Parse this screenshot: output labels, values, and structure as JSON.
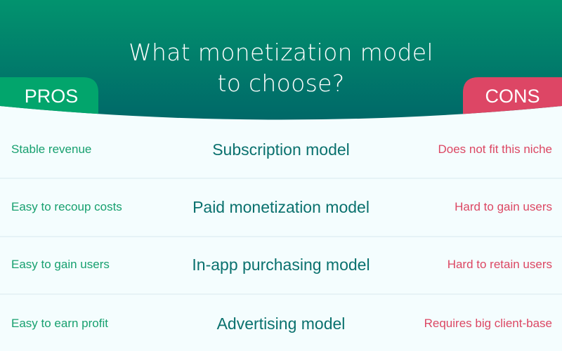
{
  "title": {
    "line1": "What monetization model",
    "line2": "to choose?"
  },
  "tabs": {
    "pros": "PROS",
    "cons": "CONS"
  },
  "colors": {
    "header_top": "#02936e",
    "header_bottom": "#006a69",
    "pros_accent": "#02a56c",
    "cons_accent": "#dd4665",
    "pros_text": "#17a06f",
    "cons_text": "#dc4763",
    "model_text": "#0a716e",
    "background": "#f4fdfe"
  },
  "rows": [
    {
      "pro": "Stable revenue",
      "model": "Subscription model",
      "con": "Does not fit this niche"
    },
    {
      "pro": "Easy to recoup costs",
      "model": "Paid monetization model",
      "con": "Hard to gain users"
    },
    {
      "pro": "Easy to gain users",
      "model": "In-app purchasing model",
      "con": "Hard to retain users"
    },
    {
      "pro": "Easy to earn profit",
      "model": "Advertising model",
      "con": "Requires big client-base"
    }
  ]
}
